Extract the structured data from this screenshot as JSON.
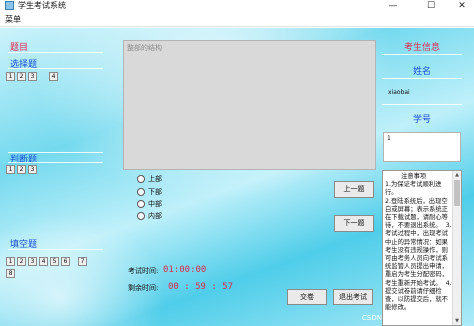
{
  "window": {
    "title": "学生考试系统",
    "minimize_glyph": "—",
    "maximize_glyph": "☐",
    "close_glyph": "✕"
  },
  "menu": {
    "label": "菜单"
  },
  "left_panel": {
    "question_header": "题目",
    "choice_section": {
      "title": "选择题",
      "buttons": [
        "1",
        "2",
        "3",
        "4"
      ]
    },
    "judge_section": {
      "title": "判断题",
      "buttons": [
        "1",
        "2",
        "3"
      ]
    },
    "fill_section": {
      "title": "填空题",
      "buttons": [
        "1",
        "2",
        "3",
        "4",
        "5",
        "6",
        "7",
        "8"
      ]
    }
  },
  "main": {
    "stem_placeholder": "整部的结构",
    "options": [
      "上部",
      "下部",
      "中部",
      "内部"
    ],
    "prev_button": "上一题",
    "next_button": "下一题",
    "exam_time_label": "考试时间:",
    "exam_time_value": "01:00:00",
    "remaining_label": "剩余时间:",
    "remaining_value": "00 : 59 : 57",
    "submit_button": "交卷",
    "exit_button": "退出考试"
  },
  "right_panel": {
    "student_info_title": "考生信息",
    "name_label": "姓名",
    "name_value": "xiaobai",
    "id_label": "学号",
    "id_value": "1",
    "notice_text": "        注意事项\n1.为保证考试顺利进行。\n2.登陆系统后，出现空白或屏幕；表示系统正在下载试题，请耐心等待，不要退出系统。  3.考试过程中，出现考试中止的异常情况：如果考生没有违规操作，则可由考务人员向考试系统监管人员提出申请，重启为考生分配密码，考生重新开始考试。  4.提交试卷前请仔细检查，以防提交后，就不能修改。"
  },
  "watermark": "CSDN @byezuoinvip",
  "colors": {
    "section_title": "#1a4fd6",
    "info_title": "#e0284f",
    "time_value": "#e0284f",
    "background_accent": "#4fcde9"
  }
}
